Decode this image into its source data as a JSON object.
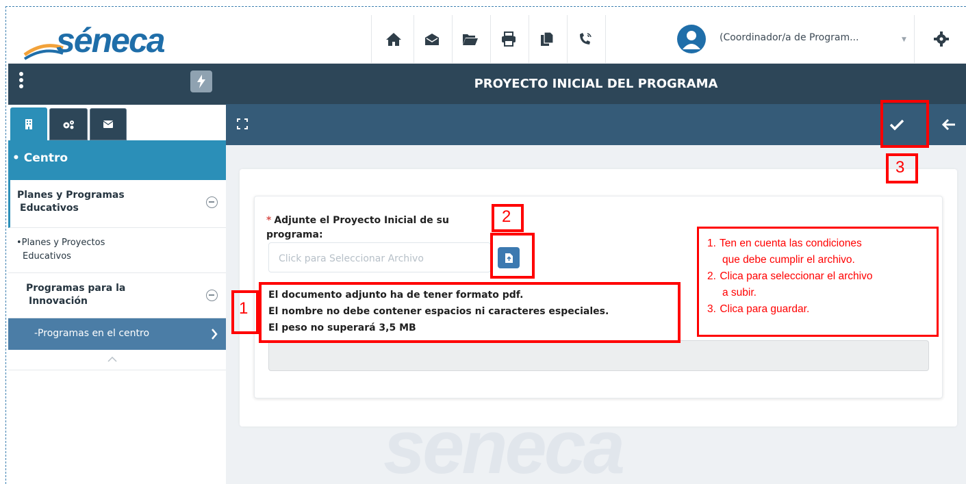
{
  "app": {
    "logo_text": "séneca",
    "watermark_text": "seneca"
  },
  "header": {
    "icons": [
      "home-icon",
      "mail-icon",
      "folder-open-icon",
      "print-icon",
      "copy-icon",
      "phone-ring-icon"
    ],
    "user_role": "(Coordinador/a de Program...",
    "settings_icon": "gear-icon"
  },
  "sidebar": {
    "tabs": [
      "building-icon",
      "cogs-icon",
      "envelope-icon"
    ],
    "section_title": "• Centro",
    "groups": [
      {
        "label_line1": "Planes y Programas",
        "label_line2": "Educativos"
      },
      {
        "label_line1": "Programas para la",
        "label_line2": "Innovación"
      }
    ],
    "items": [
      {
        "label_line1": "•Planes y Proyectos",
        "label_line2": "Educativos"
      },
      {
        "label": "-Programas en el centro"
      }
    ]
  },
  "main": {
    "title": "PROYECTO INICIAL DEL PROGRAMA",
    "form": {
      "required_mark": "*",
      "label_line1": "Adjunte el Proyecto Inicial de su",
      "label_line2": "programa:",
      "file_placeholder": "Click para Seleccionar Archivo",
      "info_lines": [
        "El documento adjunto ha de tener formato pdf.",
        "El nombre no debe contener espacios ni caracteres especiales.",
        "El peso no superará 3,5 MB"
      ]
    }
  },
  "annotations": {
    "numbers": [
      "1",
      "2",
      "3"
    ],
    "legend": [
      {
        "num": "1.",
        "line1": "Ten en cuenta las condiciones",
        "line2": "que debe cumplir el archivo."
      },
      {
        "num": "2.",
        "line1": "Clica para seleccionar el archivo",
        "line2": "a subir."
      },
      {
        "num": "3.",
        "line1": "Clica para guardar.",
        "line2": ""
      }
    ],
    "color": "#ff0000"
  },
  "colors": {
    "header_dark": "#2d4658",
    "toolbar": "#355b78",
    "section_blue": "#2b8fb8",
    "active_item": "#4b7da6",
    "brand_blue": "#1f6ea9"
  }
}
